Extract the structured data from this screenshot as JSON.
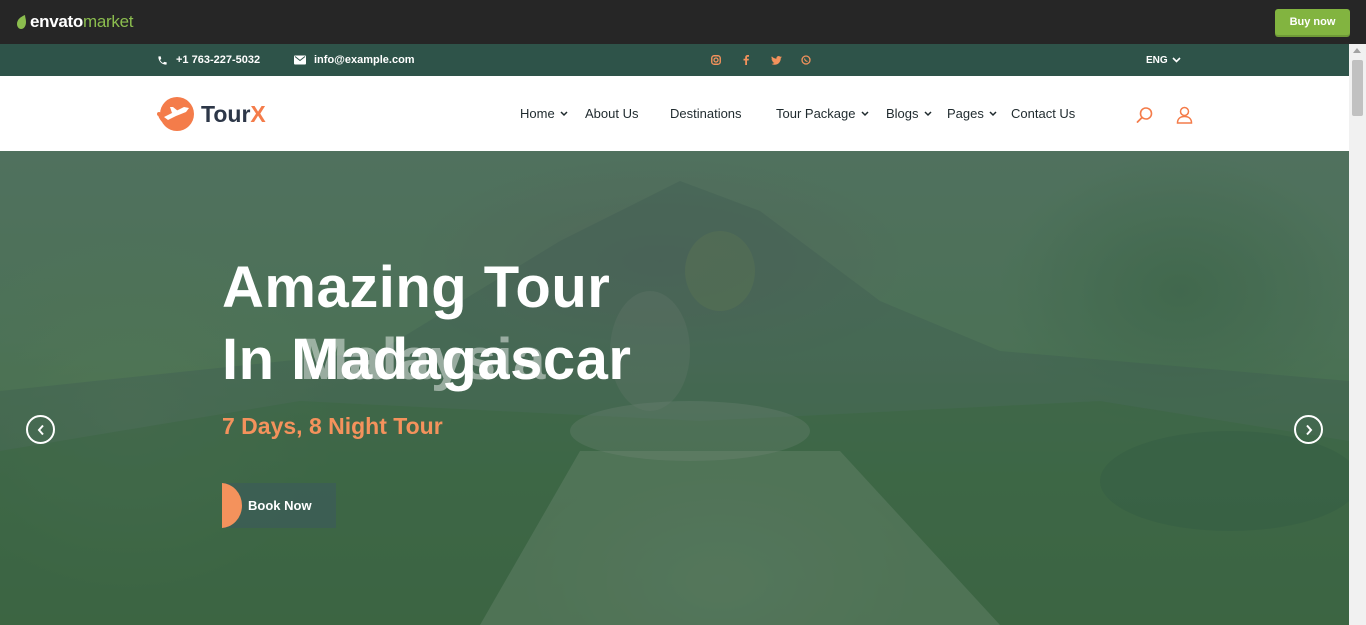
{
  "envato": {
    "logo_word": "envato",
    "logo_market": "market",
    "buy_now": "Buy now"
  },
  "topbar": {
    "phone": "+1 763-227-5032",
    "email": "info@example.com",
    "socials": [
      "instagram-icon",
      "facebook-icon",
      "twitter-icon",
      "whatsapp-icon"
    ],
    "language": "ENG"
  },
  "header": {
    "brand_main": "Tour",
    "brand_accent": "X",
    "nav": [
      {
        "label": "Home",
        "dropdown": true
      },
      {
        "label": "About Us",
        "dropdown": false
      },
      {
        "label": "Destinations",
        "dropdown": false
      },
      {
        "label": "Tour Package",
        "dropdown": true
      },
      {
        "label": "Blogs",
        "dropdown": true
      },
      {
        "label": "Pages",
        "dropdown": true
      },
      {
        "label": "Contact Us",
        "dropdown": false
      }
    ]
  },
  "hero": {
    "title_line1": "Amazing Tour",
    "title_line2": "In Madagascar",
    "title_ghost": "Malaysia",
    "subtitle": "7 Days, 8 Night Tour",
    "cta": "Book Now"
  },
  "colors": {
    "accent": "#f47c4a",
    "topbar": "#2e5349",
    "envato_bar": "#262626",
    "buy_button": "#82b440"
  }
}
